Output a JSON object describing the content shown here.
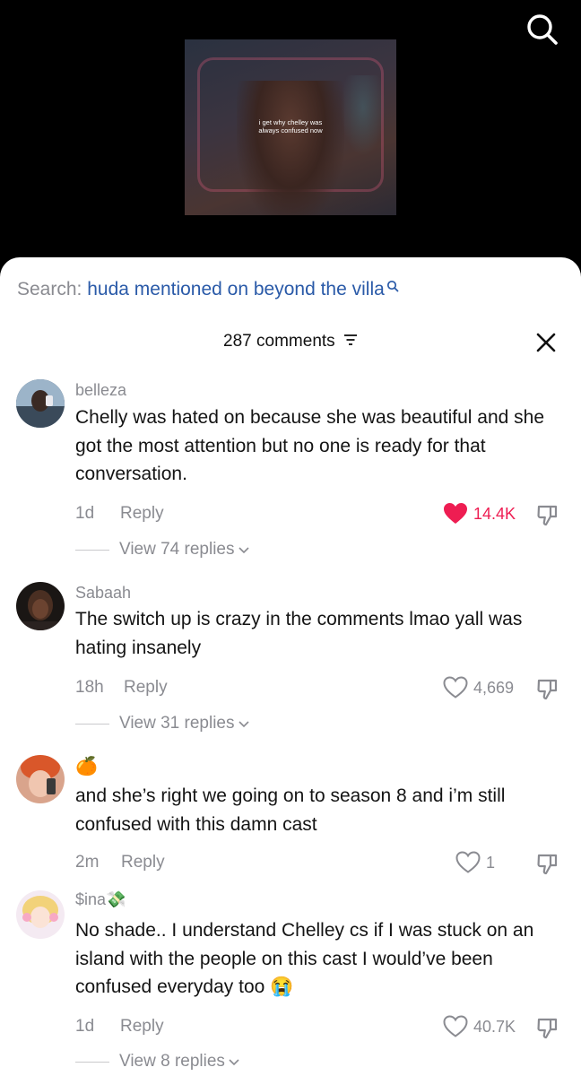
{
  "video": {
    "caption_line1": "i get why chelley was",
    "caption_line2": "always confused now"
  },
  "search": {
    "label": "Search:",
    "term": "huda mentioned on beyond the villa"
  },
  "header": {
    "comments_count": "287 comments"
  },
  "colors": {
    "liked": "#ee1d52",
    "search_term": "#2a5aa8",
    "muted": "#8a8b91"
  },
  "comments": [
    {
      "username": "belleza",
      "text": "Chelly was hated on because she was beautiful and she got the most attention but no one is ready for that conversation.",
      "time": "1d",
      "reply": "Reply",
      "likes": "14.4K",
      "liked": true,
      "view_replies": "View 74 replies"
    },
    {
      "username": "Sabaah",
      "text": "The switch up is crazy in the comments lmao yall was hating insanely",
      "time": "18h",
      "reply": "Reply",
      "likes": "4,669",
      "liked": false,
      "view_replies": "View 31 replies"
    },
    {
      "username": "🍊",
      "text": "and she’s right we going on to season 8 and i’m still confused with this damn cast",
      "time": "2m",
      "reply": "Reply",
      "likes": "1",
      "liked": false
    },
    {
      "username": "$ina💸",
      "text": "No shade.. I understand Chelley cs if I was stuck on an island with the people on this cast I would’ve been confused everyday too 😭",
      "time": "1d",
      "reply": "Reply",
      "likes": "40.7K",
      "liked": false,
      "view_replies": "View 8 replies"
    }
  ]
}
